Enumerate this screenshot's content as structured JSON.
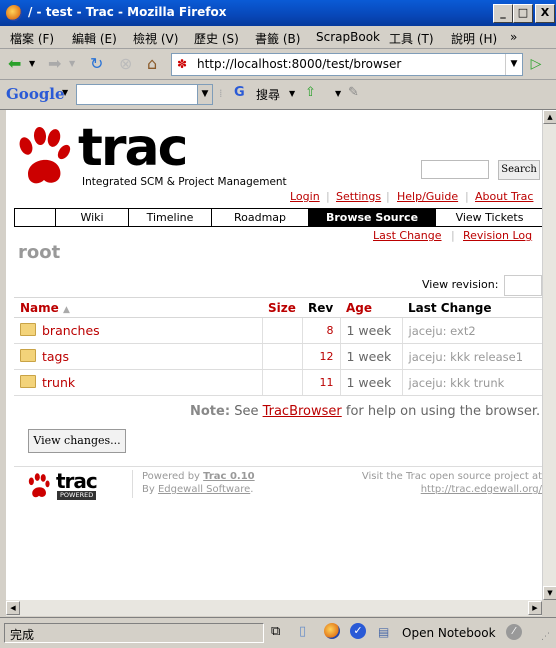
{
  "window": {
    "title": "/ - test - Trac - Mozilla Firefox",
    "controls": {
      "minimize": "_",
      "maximize": "□",
      "close": "X"
    }
  },
  "menu": [
    "檔案 (F)",
    "編輯 (E)",
    "檢視 (V)",
    "歷史 (S)",
    "書籤 (B)",
    "ScrapBook",
    "工具 (T)",
    "說明 (H)",
    "»"
  ],
  "navbar": {
    "url": "http://localhost:8000/test/browser"
  },
  "googlebar": {
    "logo": "Google",
    "search_label": "搜尋",
    "g_label": "G"
  },
  "trac": {
    "logo_text": "trac",
    "logo_subtitle": "Integrated SCM & Project Management",
    "search_button": "Search",
    "metanav": [
      "Login",
      "Settings",
      "Help/Guide",
      "About Trac"
    ],
    "mainnav": [
      {
        "label": "",
        "active": false
      },
      {
        "label": "Wiki",
        "active": false
      },
      {
        "label": "Timeline",
        "active": false
      },
      {
        "label": "Roadmap",
        "active": false
      },
      {
        "label": "Browse Source",
        "active": true
      },
      {
        "label": "View Tickets",
        "active": false
      }
    ],
    "ctxnav": [
      "Last Change",
      "Revision Log"
    ],
    "heading": "root",
    "view_revision_label": "View revision:",
    "table": {
      "headers": {
        "name": "Name",
        "size": "Size",
        "rev": "Rev",
        "age": "Age",
        "last_change": "Last Change"
      },
      "rows": [
        {
          "name": "branches",
          "size": "",
          "rev": "8",
          "age": "1 week",
          "last_change": "jaceju: ext2"
        },
        {
          "name": "tags",
          "size": "",
          "rev": "12",
          "age": "1 week",
          "last_change": "jaceju: kkk release1"
        },
        {
          "name": "trunk",
          "size": "",
          "rev": "11",
          "age": "1 week",
          "last_change": "jaceju: kkk trunk"
        }
      ]
    },
    "note": {
      "label": "Note:",
      "pre": "See",
      "link": "TracBrowser",
      "post": "for help on using the browser."
    },
    "view_changes_button": "View changes...",
    "footer": {
      "logo_text": "trac",
      "logo_badge": "POWERED",
      "powered_by": "Powered by",
      "trac_version": "Trac 0.10",
      "by_text": "By",
      "edgewall": "Edgewall Software",
      "visit_text": "Visit the Trac open source project at",
      "visit_url": "http://trac.edgewall.org/"
    }
  },
  "statusbar": {
    "status": "完成",
    "notebook": "Open Notebook"
  },
  "colors": {
    "accent": "#bb0000",
    "titlebar": "#0a5bd6",
    "active_tab": "#000000"
  }
}
